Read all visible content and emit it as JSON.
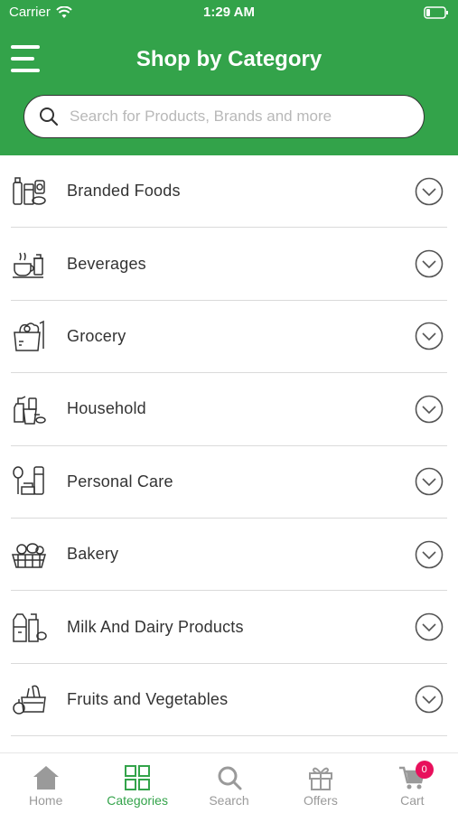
{
  "status_bar": {
    "carrier": "Carrier",
    "time": "1:29 AM"
  },
  "header": {
    "title": "Shop by Category",
    "search_placeholder": "Search for Products, Brands and more"
  },
  "colors": {
    "brand_green": "#33a34a",
    "badge_pink": "#e8105c",
    "inactive_gray": "#9a9a9a"
  },
  "categories": [
    {
      "label": "Branded Foods",
      "icon": "branded-foods-icon"
    },
    {
      "label": "Beverages",
      "icon": "beverages-icon"
    },
    {
      "label": "Grocery",
      "icon": "grocery-icon"
    },
    {
      "label": "Household",
      "icon": "household-icon"
    },
    {
      "label": "Personal Care",
      "icon": "personal-care-icon"
    },
    {
      "label": "Bakery",
      "icon": "bakery-icon"
    },
    {
      "label": "Milk And Dairy Products",
      "icon": "milk-dairy-icon"
    },
    {
      "label": "Fruits and Vegetables",
      "icon": "fruits-vegetables-icon"
    }
  ],
  "tabs": [
    {
      "label": "Home",
      "icon": "home-icon"
    },
    {
      "label": "Categories",
      "icon": "categories-grid-icon",
      "active": true
    },
    {
      "label": "Search",
      "icon": "search-icon"
    },
    {
      "label": "Offers",
      "icon": "gift-icon"
    },
    {
      "label": "Cart",
      "icon": "cart-icon",
      "badge": "0"
    }
  ]
}
